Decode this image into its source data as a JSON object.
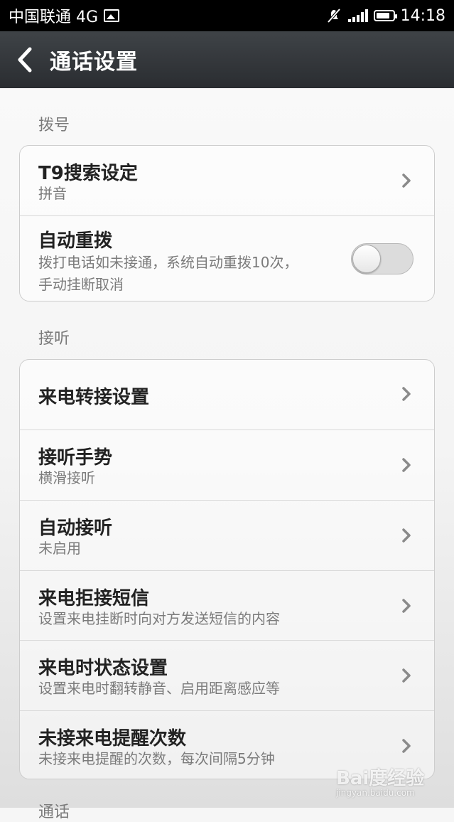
{
  "status_bar": {
    "carrier": "中国联通 4G",
    "time": "14:18",
    "icons": [
      "image-icon",
      "mute-icon",
      "signal-icon",
      "battery-icon"
    ]
  },
  "titlebar": {
    "back_icon": "chevron-left-icon",
    "title": "通话设置"
  },
  "sections": {
    "dial": {
      "header": "拨号",
      "items": [
        {
          "title": "T9搜索设定",
          "subtitle": "拼音"
        },
        {
          "title": "自动重拨",
          "subtitle_line1": "拨打电话如未接通，系统自动重拨10次，",
          "subtitle_line2": "手动挂断取消",
          "toggle_on": false
        }
      ]
    },
    "answer": {
      "header": "接听",
      "items": [
        {
          "title": "来电转接设置"
        },
        {
          "title": "接听手势",
          "subtitle": "横滑接听"
        },
        {
          "title": "自动接听",
          "subtitle": "未启用"
        },
        {
          "title": "来电拒接短信",
          "subtitle": "设置来电挂断时向对方发送短信的内容"
        },
        {
          "title": "来电时状态设置",
          "subtitle": "设置来电时翻转静音、启用距离感应等"
        },
        {
          "title": "未接来电提醒次数",
          "subtitle": "未接来电提醒的次数，每次间隔5分钟"
        }
      ]
    },
    "call": {
      "header": "通话"
    }
  },
  "watermark": {
    "brand": "Bai度经验",
    "url": "jingyan.baidu.com"
  }
}
